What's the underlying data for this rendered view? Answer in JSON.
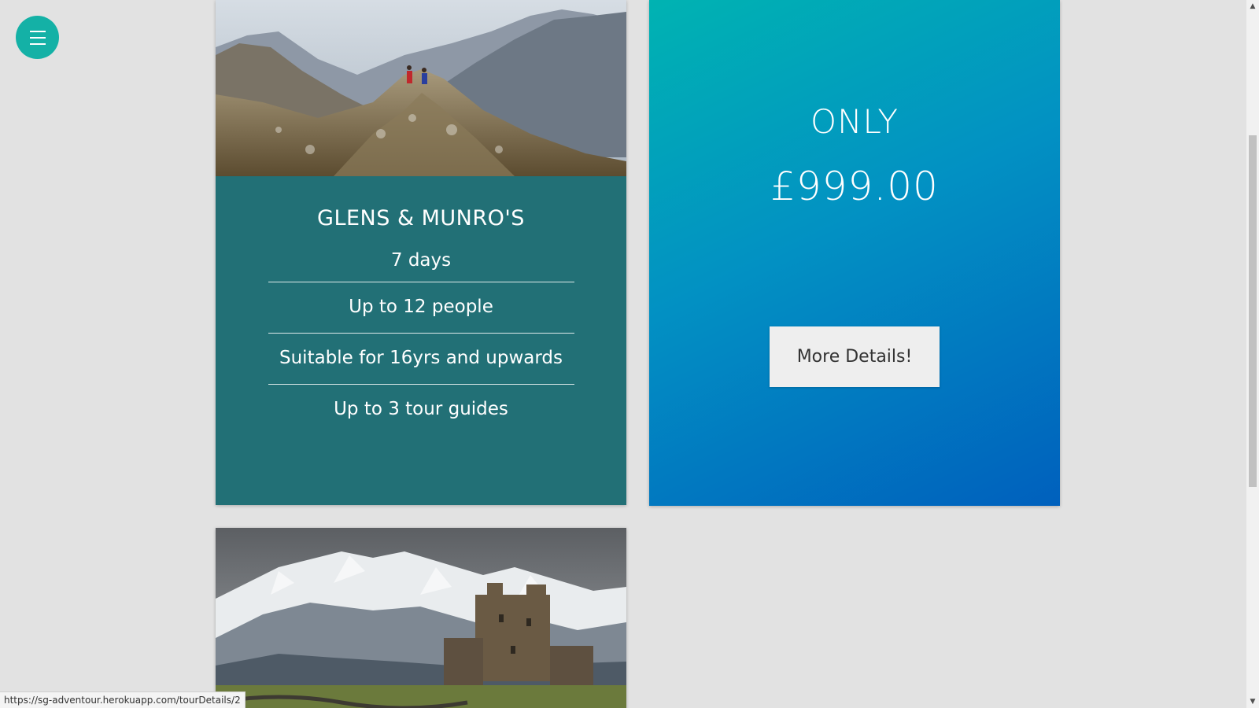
{
  "menu": {
    "icon": "hamburger-menu-icon"
  },
  "tour": {
    "title": "GLENS & MUNRO'S",
    "features": [
      "7 days",
      "Up to 12 people",
      "Suitable for 16yrs and upwards",
      "Up to 3 tour guides"
    ]
  },
  "pricing": {
    "label": "ONLY",
    "price": "£999.00",
    "button_label": "More Details!"
  },
  "status_bar": {
    "url": "https://sg-adventour.herokuapp.com/tourDetails/2"
  },
  "colors": {
    "accent": "#14b1a6",
    "card_bg": "#227076",
    "gradient_start": "#00b3b2",
    "gradient_end": "#0060bd",
    "page_bg": "#e2e2e2"
  }
}
